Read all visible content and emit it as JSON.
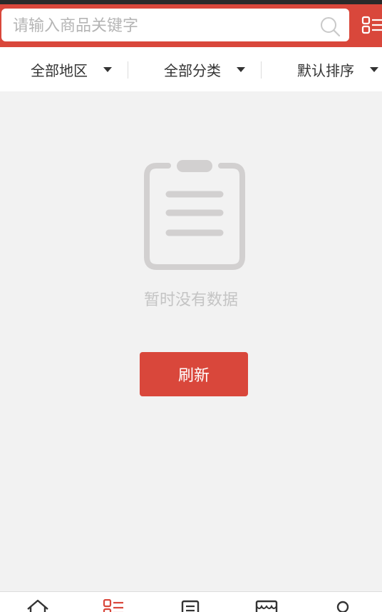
{
  "search": {
    "placeholder": "请输入商品关键字"
  },
  "filters": [
    {
      "label": "全部地区"
    },
    {
      "label": "全部分类"
    },
    {
      "label": "默认排序"
    }
  ],
  "empty_state": {
    "message": "暂时没有数据",
    "icon": "clipboard-icon"
  },
  "refresh": {
    "label": "刷新"
  },
  "bottom_nav": {
    "items": [
      {
        "icon": "home-icon"
      },
      {
        "icon": "category-icon",
        "active": true
      },
      {
        "icon": "news-icon"
      },
      {
        "icon": "store-icon"
      },
      {
        "icon": "user-icon"
      }
    ]
  },
  "colors": {
    "accent": "#d9473b",
    "background": "#f2f2f2",
    "muted": "#c4c4c4"
  }
}
